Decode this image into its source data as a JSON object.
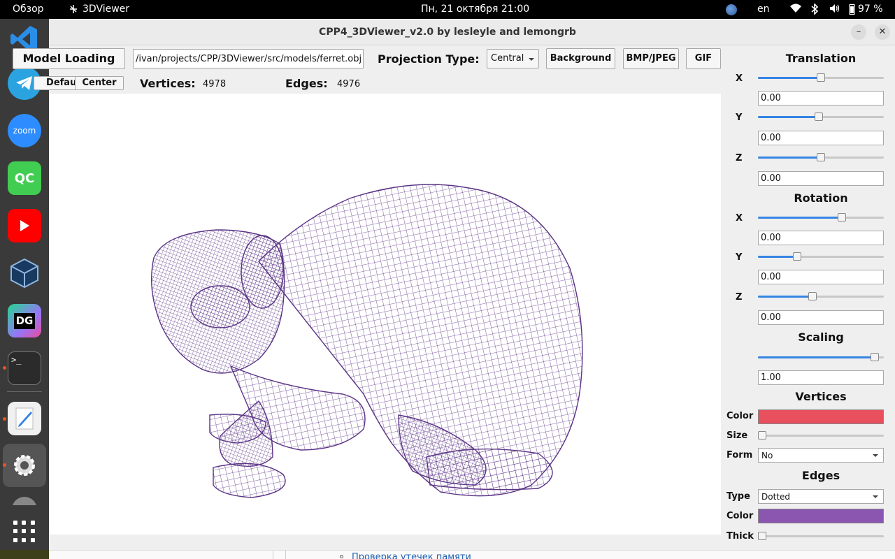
{
  "topbar": {
    "overview": "Обзор",
    "app_name": "3DViewer",
    "clock": "Пн, 21 октября  21:00",
    "lang": "en",
    "battery": "97 %"
  },
  "dock": {
    "apps": [
      {
        "name": "Visual Studio Code",
        "icon": "vscode-icon"
      },
      {
        "name": "Telegram",
        "icon": "telegram-icon"
      },
      {
        "name": "Zoom",
        "icon": "zoom-icon",
        "text": "zoom"
      },
      {
        "name": "Qt Creator",
        "icon": "qtcreator-icon",
        "text": "QC"
      },
      {
        "name": "YouTube",
        "icon": "youtube-icon"
      },
      {
        "name": "VirtualBox",
        "icon": "virtualbox-icon"
      },
      {
        "name": "DataGrip",
        "icon": "datagrip-icon",
        "text": "DG"
      },
      {
        "name": "Terminal",
        "icon": "terminal-icon",
        "text": ">_"
      },
      {
        "name": "Text Editor",
        "icon": "text-editor-icon"
      },
      {
        "name": "Settings",
        "icon": "settings-icon"
      }
    ]
  },
  "window": {
    "title": "CPP4_3DViewer_v2.0 by lesleyle and lemongrb"
  },
  "toolbar": {
    "model_loading": "Model Loading",
    "path": "/ivan/projects/CPP/3DViewer/src/models/ferret.obj",
    "projection_label": "Projection Type:",
    "projection_value": "Central",
    "background": "Background",
    "bmp_jpeg": "BMP/JPEG",
    "gif": "GIF",
    "default": "Default",
    "center": "Center",
    "vertices_label": "Vertices:",
    "vertices_value": "4978",
    "edges_label": "Edges:",
    "edges_value": "4976"
  },
  "panel": {
    "translation_title": "Translation",
    "rotation_title": "Rotation",
    "scaling_title": "Scaling",
    "vertices_title": "Vertices",
    "edges_title": "Edges",
    "axis_x": "X",
    "axis_y": "Y",
    "axis_z": "Z",
    "translation": {
      "x": "0.00",
      "y": "0.00",
      "z": "0.00"
    },
    "rotation": {
      "x": "0.00",
      "y": "0.00",
      "z": "0.00"
    },
    "scaling": "1.00",
    "slider_levels": {
      "translation_x": 0.5,
      "translation_y": 0.48,
      "translation_z": 0.5,
      "rotation_x": 0.68,
      "rotation_y": 0.3,
      "rotation_z": 0.43,
      "scaling": 0.96,
      "vertex_size": 0.0,
      "edge_thick": 0.0
    },
    "color_label": "Color",
    "size_label": "Size",
    "form_label": "Form",
    "form_value": "No",
    "type_label": "Type",
    "type_value": "Dotted",
    "thick_label": "Thick",
    "vertex_color": "#e8505e",
    "edge_color": "#8a56b0"
  },
  "model": {
    "wire_color": "#5b3486"
  },
  "below": {
    "link": "Проверка утечек памяти"
  }
}
